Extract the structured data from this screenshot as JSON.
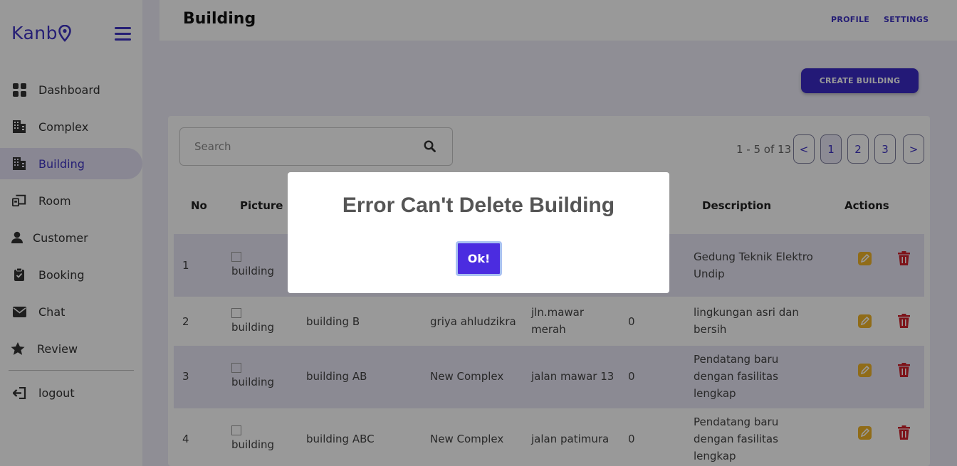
{
  "app": {
    "logo": "Kanb"
  },
  "sidebar": {
    "items": [
      {
        "label": "Dashboard",
        "icon": "dashboard-icon"
      },
      {
        "label": "Complex",
        "icon": "building-icon"
      },
      {
        "label": "Building",
        "icon": "building-icon",
        "active": true
      },
      {
        "label": "Room",
        "icon": "room-icon"
      },
      {
        "label": "Customer",
        "icon": "user-icon"
      },
      {
        "label": "Booking",
        "icon": "clipboard-icon"
      },
      {
        "label": "Chat",
        "icon": "envelope-icon"
      },
      {
        "label": "Review",
        "icon": "star-icon"
      }
    ],
    "logout": "logout"
  },
  "header": {
    "title": "Building",
    "profile": "PROFILE",
    "settings": "SETTINGS"
  },
  "toolbar": {
    "create_label": "CREATE BUILDING"
  },
  "search": {
    "placeholder": "Search"
  },
  "pagination": {
    "range": "1 - 5 of 13",
    "prev": "<",
    "next": ">",
    "pages": [
      "1",
      "2",
      "3"
    ],
    "current": "1"
  },
  "table": {
    "headers": {
      "no": "No",
      "picture": "Picture",
      "description": "Description",
      "actions": "Actions"
    },
    "rows": [
      {
        "no": "1",
        "picture_alt": "building",
        "name": "",
        "complex": "",
        "address": "",
        "count": "",
        "description": "Gedung Teknik Elektro Undip"
      },
      {
        "no": "2",
        "picture_alt": "building",
        "name": "building B",
        "complex": "griya ahludzikra",
        "address": "jln.mawar merah",
        "count": "0",
        "description": "lingkungan asri dan bersih"
      },
      {
        "no": "3",
        "picture_alt": "building",
        "name": "building AB",
        "complex": "New Complex",
        "address": "jalan mawar 13",
        "count": "0",
        "description": "Pendatang baru dengan fasilitas lengkap"
      },
      {
        "no": "4",
        "picture_alt": "building",
        "name": "building ABC",
        "complex": "New Complex",
        "address": "jalan patimura",
        "count": "0",
        "description": "Pendatang baru dengan fasilitas lengkap"
      }
    ]
  },
  "modal": {
    "title": "Error Can't Delete Building",
    "ok_label": "Ok!"
  },
  "colors": {
    "primary": "#3f33c4",
    "edit": "#f0b429",
    "delete": "#d0202a"
  }
}
